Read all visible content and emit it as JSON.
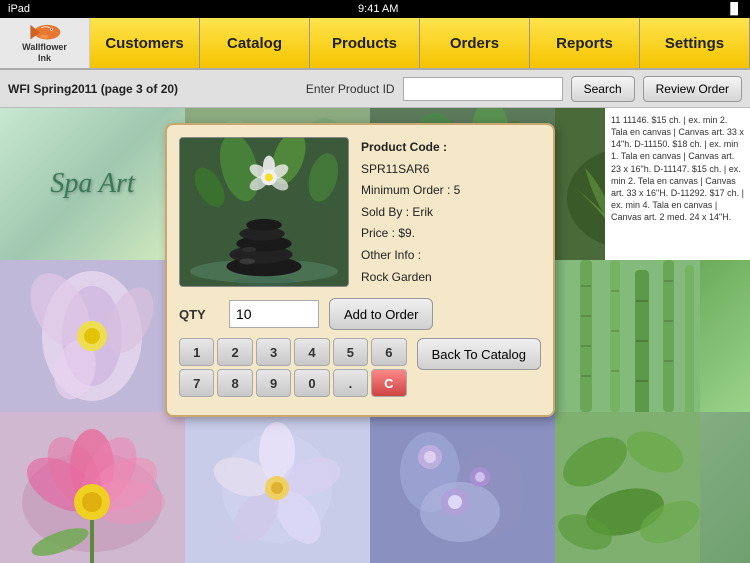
{
  "statusBar": {
    "carrier": "iPad",
    "time": "9:41 AM",
    "battery": "🔋"
  },
  "header": {
    "logo": {
      "line1": "Wallflower",
      "line2": "Ink"
    },
    "tabs": [
      {
        "id": "customers",
        "label": "Customers",
        "active": true
      },
      {
        "id": "catalog",
        "label": "Catalog",
        "active": true
      },
      {
        "id": "products",
        "label": "Products",
        "active": true
      },
      {
        "id": "orders",
        "label": "Orders",
        "active": true
      },
      {
        "id": "reports",
        "label": "Reports",
        "active": true
      },
      {
        "id": "settings",
        "label": "Settings",
        "active": true
      }
    ]
  },
  "toolbar": {
    "title": "WFI Spring2011 (page 3 of 20)",
    "searchLabel": "Enter Product ID",
    "searchButton": "Search",
    "reviewButton": "Review Order"
  },
  "product": {
    "code_label": "Product Code :",
    "code_value": "SPR11SAR6",
    "min_order_label": "Minimum Order : 5",
    "sold_by_label": "Sold By : Erik",
    "price_label": "Price : $9.",
    "other_info_label": "Other Info :",
    "other_info_value": "Rock Garden"
  },
  "qty": {
    "label": "QTY",
    "value": "10"
  },
  "buttons": {
    "add_to_order": "Add to Order",
    "back_to_catalog": "Back To Catalog"
  },
  "numpad": {
    "keys": [
      "1",
      "2",
      "3",
      "4",
      "5",
      "6",
      "7",
      "8",
      "9",
      "0",
      ".",
      "C"
    ]
  },
  "rightSidebarText": "11 11146. $15 ch. | ex. min 2. Tala en canvas | Canvas art. 33 x 14\"h. D-11150. $18 ch. | ex. min 1. Tala en canvas | Canvas art. 23 x 16\"h. D-11147. $15 ch. | ex. min 2. Tela en canvas | Canvas art. 33 x 16\"H. D-11292. $17 ch. | ex. min 4. Tala en canvas | Canvas art. 2 med. 24 x 14\"H."
}
